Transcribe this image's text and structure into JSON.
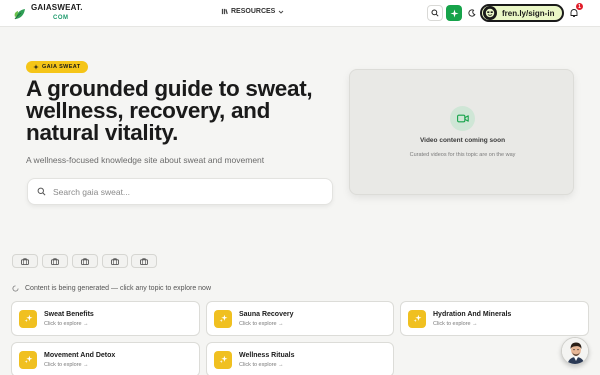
{
  "header": {
    "logo_name": "GAIASWEAT.",
    "logo_tld": "COM",
    "nav_resources": "RESOURCES",
    "signin_label": "fren.ly/sign-in",
    "notification_count": "1"
  },
  "hero": {
    "pill_label": "GAIA SWEAT",
    "title": "A grounded guide to sweat, wellness, recovery, and natural vitality.",
    "subtitle": "A wellness-focused knowledge site about sweat and movement",
    "search_placeholder": "Search gaia sweat..."
  },
  "video": {
    "title": "Video content coming soon",
    "subtitle": "Curated videos for this topic are on the way"
  },
  "status_text": "Content is being generated — click any topic to explore now",
  "topics": [
    {
      "title": "Sweat Benefits",
      "sub": "Click to explore →"
    },
    {
      "title": "Sauna Recovery",
      "sub": "Click to explore →"
    },
    {
      "title": "Hydration And Minerals",
      "sub": "Click to explore →"
    },
    {
      "title": "Movement And Detox",
      "sub": "Click to explore →"
    },
    {
      "title": "Wellness Rituals",
      "sub": "Click to explore →"
    }
  ],
  "colors": {
    "accent_green": "#16a34a",
    "accent_yellow": "#f5c518",
    "signin_bg": "#eaf7c6",
    "badge_red": "#e11d2a"
  },
  "icons": {
    "logo": "leaf-icon",
    "search": "search-icon",
    "sparkle": "sparkle-icon",
    "theme": "moon-icon",
    "notifications": "bell-icon",
    "video": "video-camera-icon",
    "chip": "briefcase-icon",
    "status": "loading-icon"
  }
}
